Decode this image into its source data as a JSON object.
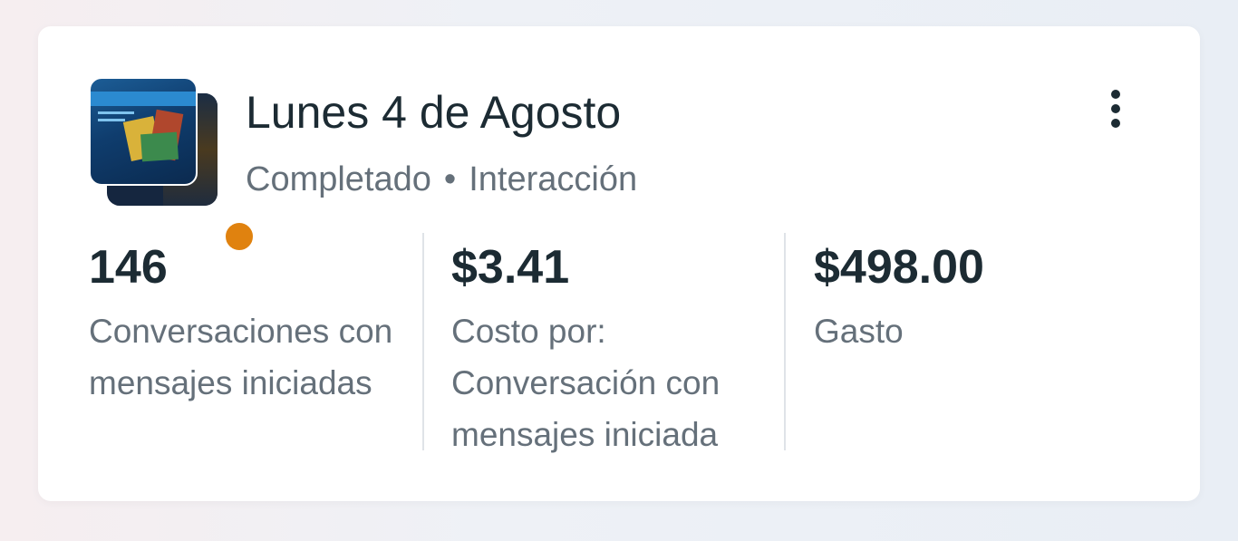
{
  "card": {
    "title": "Lunes 4 de Agosto",
    "status": "Completado",
    "separator": "•",
    "objective": "Interacción",
    "status_color": "#e0820f",
    "menu_icon": "more-vertical-icon"
  },
  "metrics": [
    {
      "value": "146",
      "label": "Conversaciones con mensajes iniciadas"
    },
    {
      "value": "$3.41",
      "label": "Costo por: Conversación con mensajes iniciada"
    },
    {
      "value": "$498.00",
      "label": "Gasto"
    }
  ]
}
